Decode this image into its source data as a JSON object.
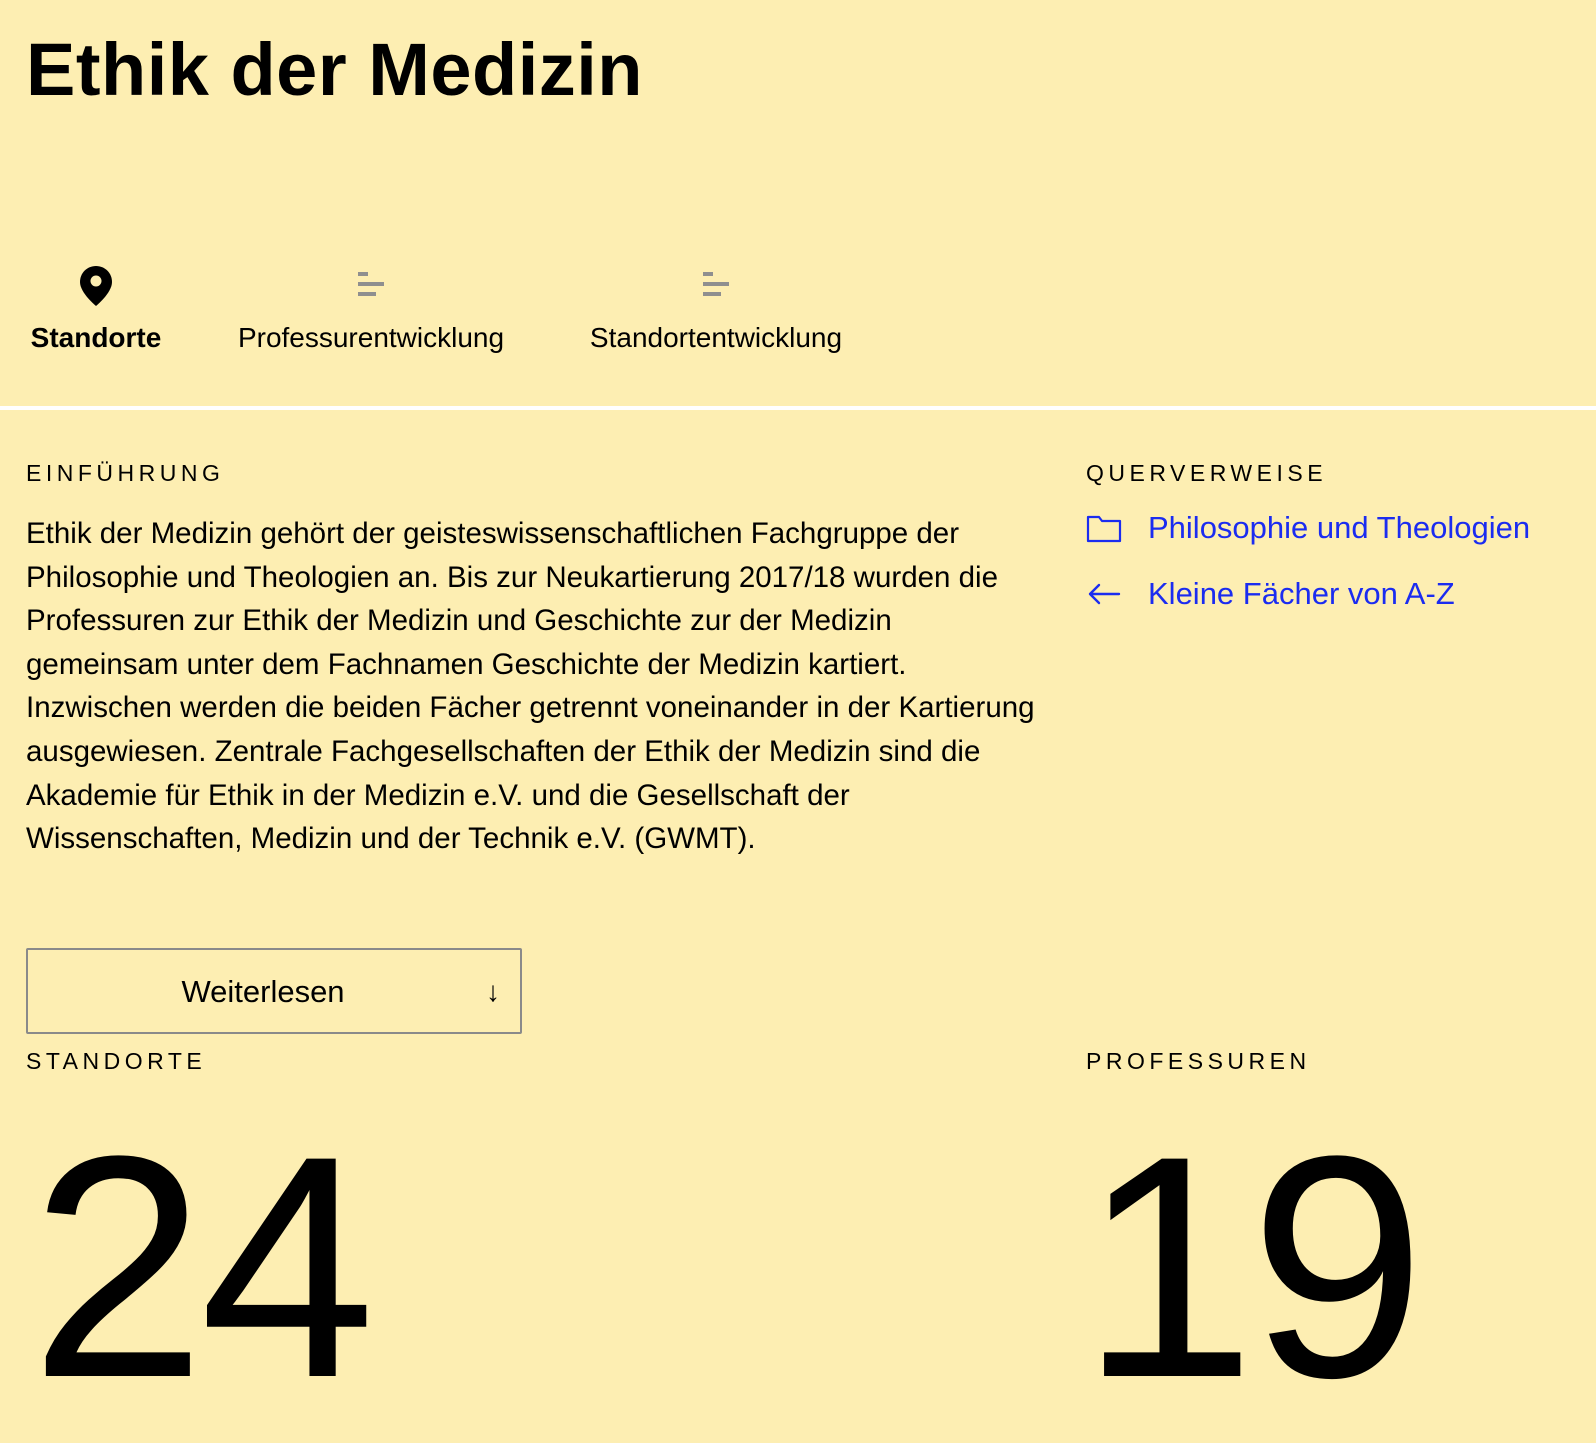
{
  "page": {
    "title": "Ethik der Medizin"
  },
  "tabs": [
    {
      "label": "Standorte",
      "icon": "map-pin-icon",
      "active": true
    },
    {
      "label": "Professurentwicklung",
      "icon": "bar-chart-icon",
      "active": false
    },
    {
      "label": "Standortentwicklung",
      "icon": "bar-chart-icon",
      "active": false
    }
  ],
  "intro": {
    "heading": "EINFÜHRUNG",
    "text": "Ethik der Medizin gehört der geisteswissenschaftlichen Fachgruppe der Philosophie und Theologien an. Bis zur Neukartierung 2017/18 wurden die Professuren zur Ethik der Medizin und Geschichte zur der Medizin gemeinsam unter dem Fachnamen Geschichte der Medizin kartiert. Inzwischen werden die beiden Fächer getrennt voneinander in der Kartierung ausgewiesen. Zentrale Fachgesellschaften der Ethik der Medizin sind die Akademie für Ethik in der Medizin e.V. und die Gesellschaft der Wissenschaften, Medizin und der Technik e.V. (GWMT).",
    "read_more_label": "Weiterlesen",
    "read_more_arrow": "↓"
  },
  "crossrefs": {
    "heading": "QUERVERWEISE",
    "links": [
      {
        "label": "Philosophie und Theologien",
        "icon": "folder-icon"
      },
      {
        "label": "Kleine Fächer von A-Z",
        "icon": "arrow-left-icon"
      }
    ]
  },
  "stats": {
    "standorte": {
      "label": "STANDORTE",
      "value": "24"
    },
    "professuren": {
      "label": "PROFESSUREN",
      "value": "19"
    }
  },
  "colors": {
    "background": "#fdeeb2",
    "link": "#1b2cf0",
    "divider": "#ffffff",
    "icon_gray": "#8f8f8f"
  }
}
